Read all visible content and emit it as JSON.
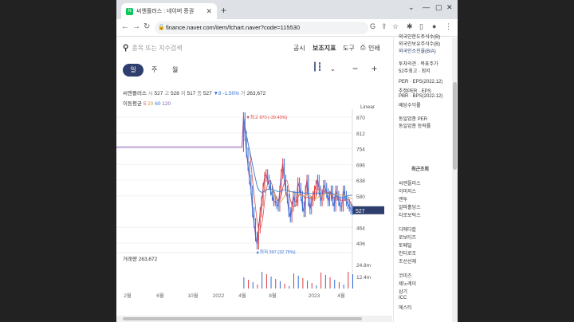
{
  "browser": {
    "tab_title": "씨엔플러스 : 네이버 증권",
    "url": "finance.naver.com/item/fchart.naver?code=115530"
  },
  "search": {
    "placeholder": "종목 또는 지수검색"
  },
  "top_menu": [
    "공시",
    "보조지표",
    "도구",
    "인쇄"
  ],
  "periods": [
    "일",
    "주",
    "월"
  ],
  "stock": {
    "name": "씨엔플러스",
    "open_label": "시",
    "open": "527",
    "high_label": "고",
    "high": "528",
    "low_label": "저",
    "low": "517",
    "close_label": "종",
    "close": "527",
    "change": "▼8",
    "change_pct": "-1.50%",
    "volume_label": "거",
    "volume": "263,672"
  },
  "ma": {
    "label": "이동평균",
    "values": [
      "5",
      "20",
      "60",
      "120"
    ]
  },
  "scale_label": "Linear",
  "volume_title": "거래량",
  "volume_value": "263,672",
  "colors": {
    "up": "#e03a3a",
    "down": "#2f6ed8",
    "ma5": "#e05050",
    "ma20": "#d4a03c",
    "ma60": "#2c7be0",
    "ma120": "#8a5ab8",
    "accent": "#2e3e6d"
  },
  "chart_data": {
    "type": "line",
    "y_ticks": [
      "870",
      "812",
      "754",
      "696",
      "638",
      "580",
      "527",
      "464",
      "406"
    ],
    "y_range": [
      406,
      870
    ],
    "x_ticks": [
      "2월",
      "6월",
      "10월",
      "2022",
      "4월",
      "8월",
      "2023",
      "4월"
    ],
    "max_label": "최고 870 (-39.43%)",
    "min_label": "최저 397 (32.75%)",
    "current": "527",
    "vol_ticks": [
      "24.8m",
      "12.4m"
    ],
    "series": [
      {
        "values": [
          760,
          760,
          760,
          760,
          760,
          760,
          760,
          760,
          760,
          760,
          760,
          760,
          760,
          760,
          760,
          760,
          760,
          760,
          760,
          760,
          760,
          760,
          760,
          760,
          760,
          760,
          760,
          760,
          760,
          760,
          760,
          760,
          760,
          760,
          760,
          760,
          760,
          760,
          760,
          760,
          760,
          760,
          760,
          760,
          760,
          760,
          760,
          760,
          760,
          760,
          760,
          760,
          760,
          760,
          760,
          760,
          760,
          760,
          760,
          760,
          760,
          760,
          760,
          760,
          760,
          760,
          760,
          760,
          760,
          760,
          760,
          760,
          760,
          760,
          760,
          760,
          760,
          760,
          760,
          760,
          760,
          760,
          760,
          760,
          870,
          800,
          740,
          690,
          640,
          600,
          520,
          480,
          430,
          400,
          460,
          520,
          560,
          610,
          650,
          660,
          640,
          620,
          600,
          580,
          560,
          560,
          550,
          540,
          600,
          660,
          700,
          640,
          600,
          570,
          520,
          500,
          540,
          580,
          560,
          560,
          630,
          610,
          580,
          540,
          520,
          600,
          640,
          560,
          530,
          560,
          580,
          600,
          620,
          640,
          600,
          560,
          580,
          620,
          610,
          590,
          560,
          580,
          600,
          560,
          540,
          600,
          580,
          560,
          540,
          540,
          600,
          580,
          560,
          550,
          540,
          530,
          527
        ]
      }
    ]
  }
}
